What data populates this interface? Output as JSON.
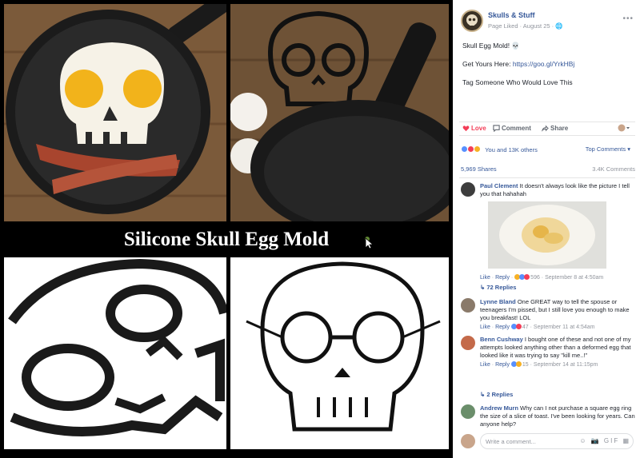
{
  "collage": {
    "banner_text": "Silicone Skull Egg Mold"
  },
  "post": {
    "page_name": "Skulls & Stuff",
    "page_meta": "Page Liked · August 25 · 🌐",
    "text_line1": "Skull Egg Mold! 💀",
    "text_line2_prefix": "Get Yours Here: ",
    "text_line2_link": "https://goo.gl/YrkHBj",
    "text_line3": "Tag Someone Who Would Love This",
    "actions": {
      "love": "Love",
      "comment": "Comment",
      "share": "Share"
    },
    "reactions_text": "You and 13K others",
    "top_comments": "Top Comments ▾",
    "shares": "5,969 Shares",
    "comments_count": "3.4K Comments",
    "comments": [
      {
        "author": "Paul Clement",
        "text": "It doesn't always look like the picture I tell you that hahahah",
        "meta_like": "Like",
        "meta_reply": "Reply",
        "meta_count": "596",
        "meta_time": "September 8 at 4:50am",
        "replies": "72 Replies"
      },
      {
        "author": "Lynne Bland",
        "text": "One GREAT way to tell the spouse or teenagers I'm pissed, but I still love you enough to make you breakfast! LOL",
        "meta_like": "Like",
        "meta_reply": "Reply",
        "meta_count": "47",
        "meta_time": "September 11 at 4:54am"
      },
      {
        "author": "Benn Cushway",
        "text": "I bought one of these and not one of my attempts looked anything other than a deformed egg that looked like it was trying to say \"kill me..!\"",
        "meta_like": "Like",
        "meta_reply": "Reply",
        "meta_count": "15",
        "meta_time": "September 14 at 11:15pm",
        "replies": "2 Replies"
      },
      {
        "author": "Andrew Murn",
        "text": "Why can I not purchase a square egg ring the size of a slice of toast. I've been looking for years. Can anyone help?"
      }
    ],
    "write_placeholder": "Write a comment...",
    "write_icons": "☺ 📷 GIF ▦"
  },
  "colors": {
    "link_blue": "#365899",
    "love_red": "#f33e58",
    "meta_grey": "#90949c"
  },
  "icons": [
    "page-avatar-skull-icon",
    "more-options-icon",
    "love-icon",
    "comment-icon",
    "share-icon",
    "profile-select-icon",
    "like-reaction-icon",
    "love-reaction-icon",
    "haha-reaction-icon",
    "reply-arrow-icon",
    "emoji-icon",
    "camera-icon",
    "gif-icon",
    "sticker-icon",
    "cursor-icon"
  ]
}
